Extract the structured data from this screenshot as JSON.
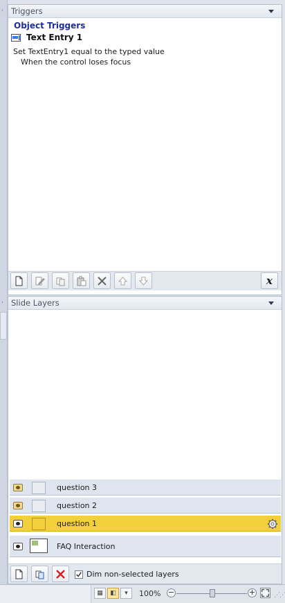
{
  "triggers_panel": {
    "title": "Triggers",
    "group_title": "Object Triggers",
    "object_name": "Text Entry 1",
    "action": "Set TextEntry1 equal to the typed value",
    "condition": "When the control loses focus",
    "toolbar_icons": [
      "new-trigger-icon",
      "edit-trigger-icon",
      "copy-icon",
      "paste-icon",
      "delete-icon",
      "move-up-icon",
      "move-down-icon",
      "variables-icon"
    ],
    "variables_glyph": "x"
  },
  "layers_panel": {
    "title": "Slide Layers",
    "layers": [
      {
        "name": "question 3",
        "selected": false
      },
      {
        "name": "question 2",
        "selected": false
      },
      {
        "name": "question 1",
        "selected": true
      }
    ],
    "base_layer": {
      "name": "FAQ Interaction"
    },
    "dim_label": "Dim non-selected layers",
    "dim_checked": true
  },
  "status_bar": {
    "zoom": "100%",
    "minus": "−",
    "plus": "+"
  },
  "colors": {
    "selected_layer": "#f2cf3b",
    "group_title": "#1f2e9c",
    "delete_red": "#d42020"
  }
}
